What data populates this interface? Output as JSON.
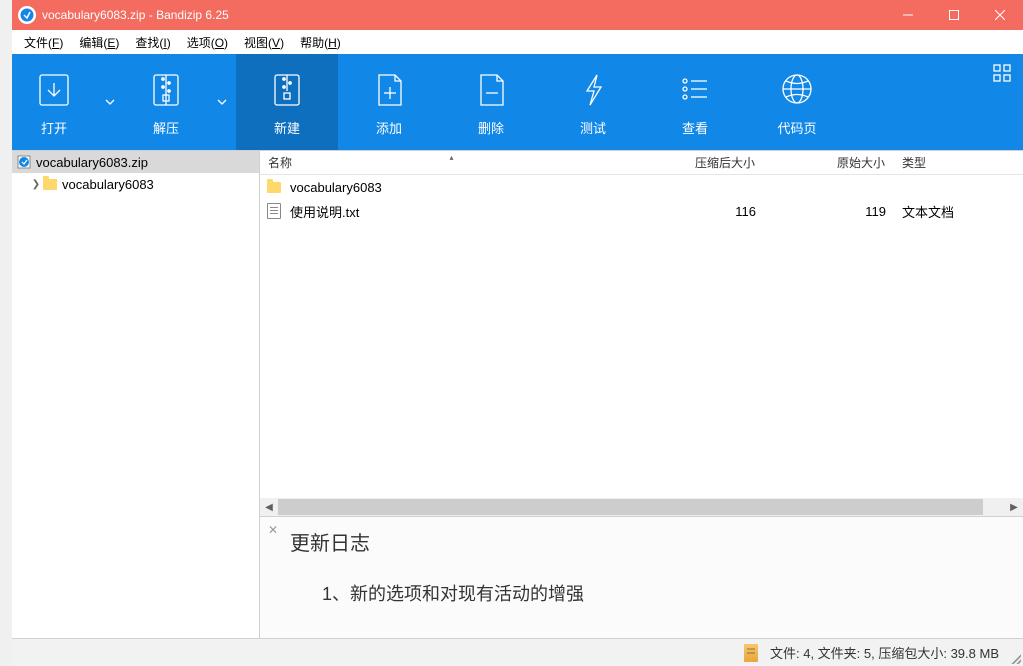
{
  "window": {
    "title": "vocabulary6083.zip - Bandizip 6.25"
  },
  "menu": {
    "items": [
      {
        "pre": "文件(",
        "key": "F",
        "post": ")"
      },
      {
        "pre": "编辑(",
        "key": "E",
        "post": ")"
      },
      {
        "pre": "查找(",
        "key": "I",
        "post": ")"
      },
      {
        "pre": "选项(",
        "key": "O",
        "post": ")"
      },
      {
        "pre": "视图(",
        "key": "V",
        "post": ")"
      },
      {
        "pre": "帮助(",
        "key": "H",
        "post": ")"
      }
    ]
  },
  "toolbar": {
    "open": "打开",
    "extract": "解压",
    "new": "新建",
    "add": "添加",
    "delete": "删除",
    "test": "测试",
    "view": "查看",
    "codepage": "代码页"
  },
  "tree": {
    "root": "vocabulary6083.zip",
    "child": "vocabulary6083"
  },
  "columns": {
    "name": "名称",
    "compressed": "压缩后大小",
    "original": "原始大小",
    "type": "类型"
  },
  "files": [
    {
      "name": "vocabulary6083",
      "icon": "folder",
      "csize": "",
      "osize": "",
      "type": ""
    },
    {
      "name": "使用说明.txt",
      "icon": "txt",
      "csize": "116",
      "osize": "119",
      "type": "文本文档"
    }
  ],
  "preview": {
    "title": "更新日志",
    "body": "1、新的选项和对现有活动的增强"
  },
  "status": {
    "text": "文件: 4, 文件夹: 5, 压缩包大小: 39.8 MB"
  }
}
